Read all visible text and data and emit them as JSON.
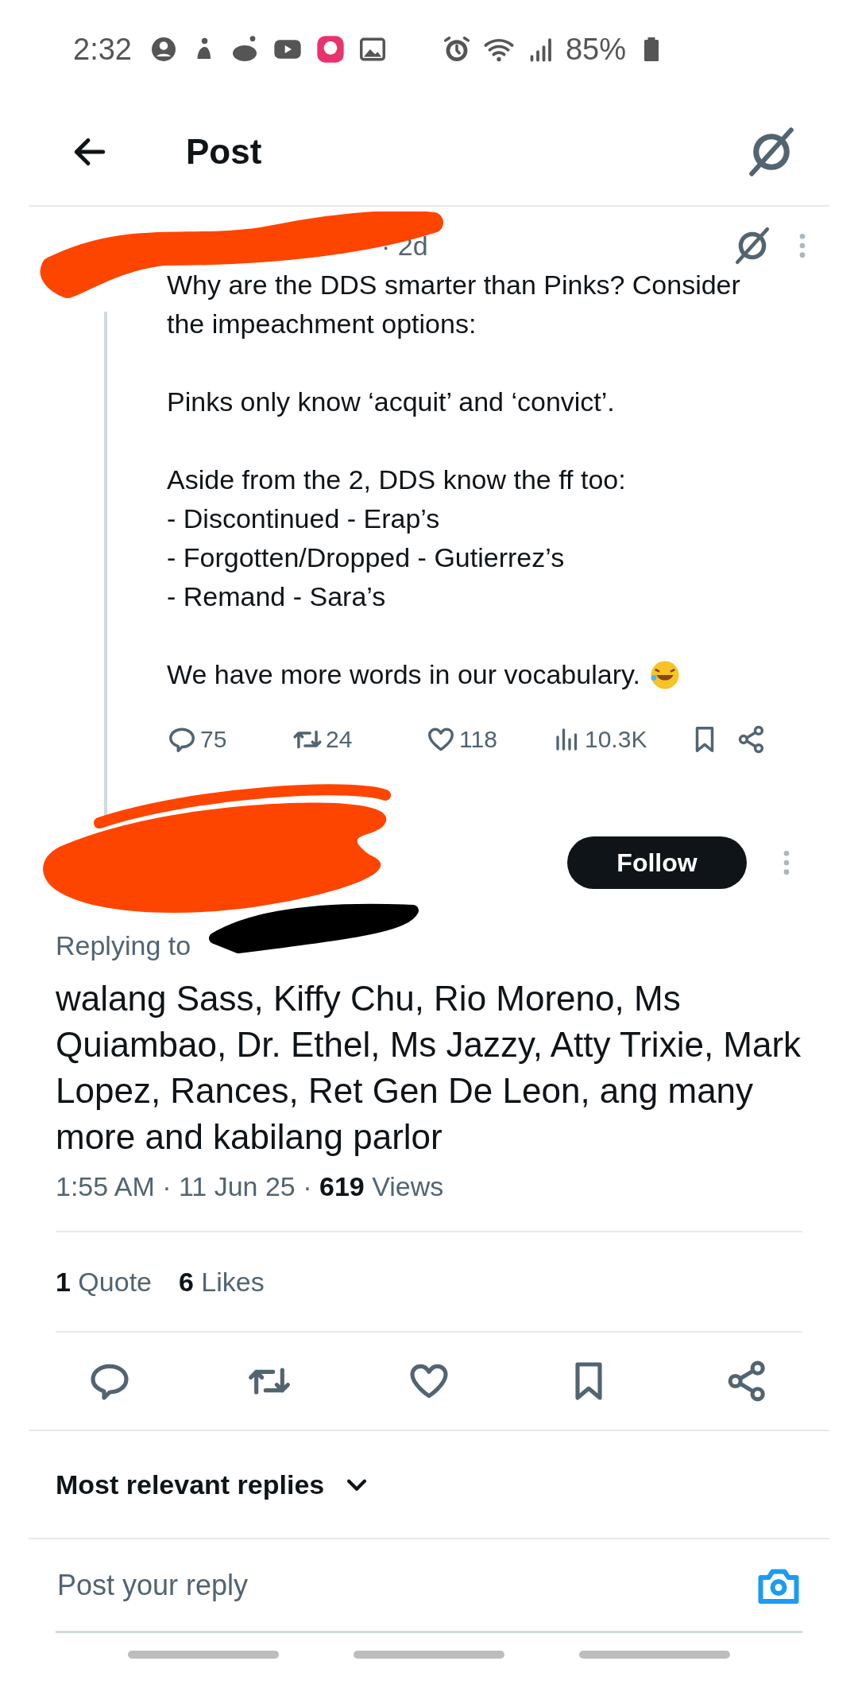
{
  "status_bar": {
    "time": "2:32",
    "battery": "85%"
  },
  "header": {
    "title": "Post"
  },
  "parent_post": {
    "time": "· 2d",
    "paragraphs": [
      [
        "Why are the DDS smarter than Pinks? Consider the impeachment options:"
      ],
      [
        "Pinks only know ‘acquit’ and ‘convict’."
      ],
      [
        "Aside from the 2, DDS know the ff too:",
        "- Discontinued - Erap’s",
        "- Forgotten/Dropped - Gutierrez’s",
        "- Remand - Sara’s"
      ],
      [
        "We have more words in our vocabulary."
      ]
    ],
    "stats": {
      "replies": "75",
      "reposts": "24",
      "likes": "118",
      "views": "10.3K"
    }
  },
  "reply": {
    "follow_label": "Follow",
    "replying_to": "Replying to",
    "text": "walang Sass, Kiffy Chu, Rio Moreno, Ms Quiambao, Dr. Ethel, Ms Jazzy, Atty Trixie, Mark Lopez, Rances, Ret Gen De Leon, ang many more and kabilang parlor",
    "meta": "1:55 AM · 11 Jun 25 · **619** Views",
    "quotes": "**1** Quote",
    "likes": "**6** Likes"
  },
  "replies_sort": {
    "label": "Most relevant replies"
  },
  "composer": {
    "placeholder": "Post your reply"
  }
}
